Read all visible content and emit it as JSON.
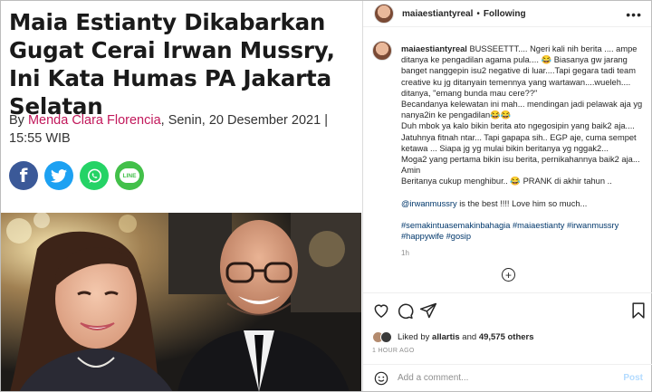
{
  "article": {
    "headline": "Maia Estianty Dikabarkan Gugat Cerai Irwan Mussry, Ini Kata Humas PA Jakarta Selatan",
    "byline_prefix": "By ",
    "author": "Menda Clara Florencia",
    "byline_date": ", Senin, 20 Desember 2021 | 15:55 WIB",
    "share": {
      "facebook": "f",
      "line": "LINE"
    }
  },
  "post": {
    "username": "maiaestiantyreal",
    "dot": "•",
    "follow": "Following",
    "caption_user": "maiaestiantyreal",
    "caption_text": " BUSSEETTT.... Ngeri kali nih berita .... ampe ditanya ke pengadilan agama pula.... 😂 Biasanya gw jarang banget nanggepin isu2 negative di luar....Tapi gegara tadi team creative ku jg ditanyain temennya yang wartawan....wueleh.... ditanya, \"emang bunda mau cere??\"\nBecandanya kelewatan ini mah... mendingan jadi pelawak aja yg nanya2in ke pengadilan😂😂\nDuh mbok ya kalo bikin berita ato ngegosipin yang baik2 aja....\nJatuhnya fitnah ntar... Tapi gapapa sih.. EGP aje, cuma sempet ketawa ... Siapa jg yg mulai bikin beritanya yg nggak2...\nMoga2 yang pertama bikin isu berita, pernikahannya baik2 aja...\nAmin\nBeritanya cukup menghibur.. 😂 PRANK di akhir tahun ..",
    "mention": "@irwanmussry",
    "mention_text": " is the best !!!! Love him so much...",
    "hashtags": "#semakintuasemakinbahagia #maiaestianty #irwanmussry #happywife #gosip",
    "time": "1h",
    "likes_prefix": "Liked by ",
    "likes_user": "allartis",
    "likes_and": " and ",
    "likes_count": "49,575 others",
    "hours_ago": "1 HOUR AGO",
    "comment_placeholder": "Add a comment...",
    "post_button": "Post"
  }
}
